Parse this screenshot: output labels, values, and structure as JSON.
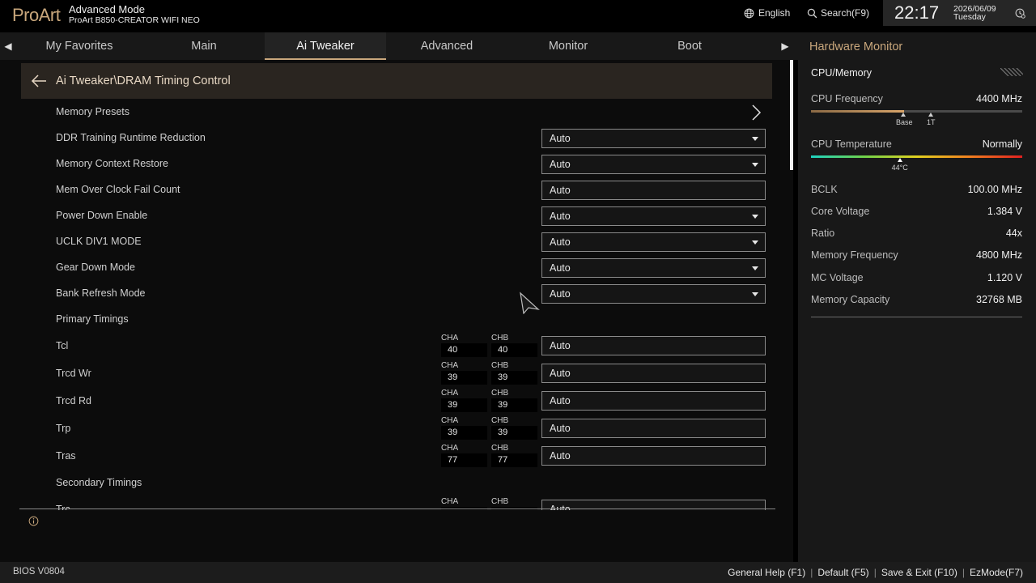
{
  "header": {
    "logo": "ProArt",
    "mode_title": "Advanced Mode",
    "board_name": "ProArt B850-CREATOR WIFI NEO",
    "language": "English",
    "search": "Search(F9)",
    "time": "22:17",
    "date": "2026/06/09",
    "weekday": "Tuesday"
  },
  "tabs": [
    {
      "label": "My Favorites"
    },
    {
      "label": "Main"
    },
    {
      "label": "Ai Tweaker",
      "active": true
    },
    {
      "label": "Advanced"
    },
    {
      "label": "Monitor"
    },
    {
      "label": "Boot"
    }
  ],
  "breadcrumb": "Ai Tweaker\\DRAM Timing Control",
  "settings": {
    "memory_presets": "Memory Presets",
    "ddr_training": {
      "label": "DDR Training Runtime Reduction",
      "value": "Auto"
    },
    "mem_context": {
      "label": "Memory Context Restore",
      "value": "Auto"
    },
    "mem_oc_fail": {
      "label": "Mem Over Clock Fail Count",
      "value": "Auto"
    },
    "power_down": {
      "label": "Power Down Enable",
      "value": "Auto"
    },
    "uclk_div1": {
      "label": "UCLK DIV1 MODE",
      "value": "Auto"
    },
    "gear_down": {
      "label": "Gear Down Mode",
      "value": "Auto"
    },
    "bank_refresh": {
      "label": "Bank Refresh Mode",
      "value": "Auto"
    },
    "primary_timings": "Primary Timings",
    "secondary_timings": "Secondary Timings"
  },
  "timings": {
    "cha_label": "CHA",
    "chb_label": "CHB",
    "tcl": {
      "label": "Tcl",
      "cha": "40",
      "chb": "40",
      "value": "Auto"
    },
    "trcd_wr": {
      "label": "Trcd Wr",
      "cha": "39",
      "chb": "39",
      "value": "Auto"
    },
    "trcd_rd": {
      "label": "Trcd Rd",
      "cha": "39",
      "chb": "39",
      "value": "Auto"
    },
    "trp": {
      "label": "Trp",
      "cha": "39",
      "chb": "39",
      "value": "Auto"
    },
    "tras": {
      "label": "Tras",
      "cha": "77",
      "chb": "77",
      "value": "Auto"
    },
    "trc": {
      "label": "Trc",
      "value": "Auto"
    }
  },
  "hardware_monitor": {
    "title": "Hardware Monitor",
    "section": "CPU/Memory",
    "cpu_frequency": {
      "label": "CPU Frequency",
      "value": "4400 MHz",
      "fill": 0.44,
      "marker_base": "Base",
      "marker_1t": "1T"
    },
    "cpu_temperature": {
      "label": "CPU Temperature",
      "value": "Normally",
      "marker": "44°C",
      "level": 0.42
    },
    "bclk": {
      "label": "BCLK",
      "value": "100.00 MHz"
    },
    "core_voltage": {
      "label": "Core Voltage",
      "value": "1.384 V"
    },
    "ratio": {
      "label": "Ratio",
      "value": "44x"
    },
    "memory_frequency": {
      "label": "Memory Frequency",
      "value": "4800 MHz"
    },
    "mc_voltage": {
      "label": "MC Voltage",
      "value": "1.120 V"
    },
    "memory_capacity": {
      "label": "Memory Capacity",
      "value": "32768 MB"
    }
  },
  "footer": {
    "bios_version": "BIOS V0804",
    "general_help": "General Help (F1)",
    "default": "Default (F5)",
    "save_exit": "Save & Exit (F10)",
    "ezmode": "EzMode(F7)"
  },
  "colors": {
    "accent": "#c9a77c",
    "breadcrumb_bg": "#2a2520",
    "panel_bg": "#181818"
  }
}
